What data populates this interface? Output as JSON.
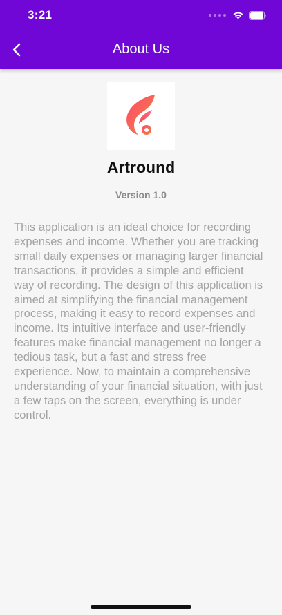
{
  "status_bar": {
    "time": "3:21"
  },
  "nav": {
    "title": "About Us",
    "back_icon": "chevron-left-icon"
  },
  "app": {
    "name": "Artround",
    "version": "Version 1.0",
    "logo_icon": "artround-flame-logo"
  },
  "about": {
    "description": "This application is an ideal choice for recording expenses and income. Whether you are tracking small daily expenses or managing larger financial transactions, it provides a simple and efficient way of recording. The design of this application is aimed at simplifying the financial management process, making it easy to record expenses and income. Its intuitive interface and user-friendly features make financial management no longer a tedious task, but a fast and stress free experience. Now, to maintain a comprehensive understanding of your financial situation, with just a few taps on the screen, everything is under control."
  },
  "colors": {
    "header": "#7007d6",
    "background": "#f6f6f6",
    "logo_gradient_start": "#ff4b6e",
    "logo_gradient_end": "#f0823c"
  }
}
